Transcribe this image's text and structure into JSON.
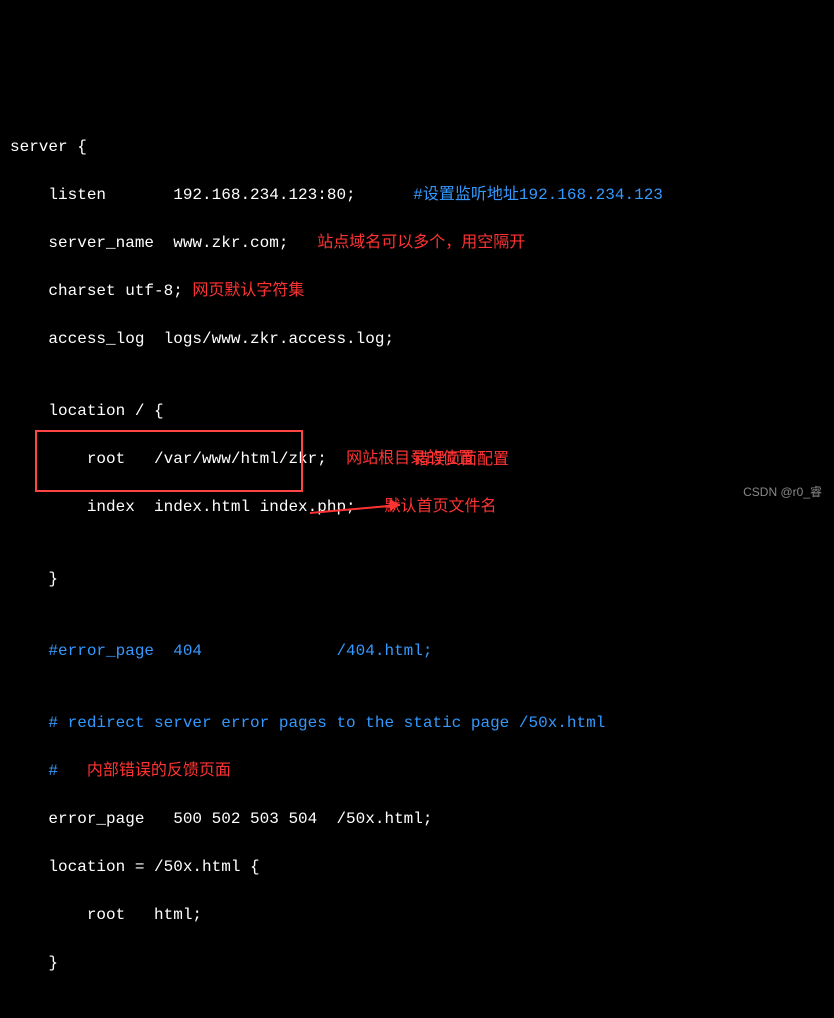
{
  "lines": {
    "l1": "server {",
    "l2a": "    listen       192.168.234.123:80;",
    "l2b": "      #设置监听地址192.168.234.123",
    "l3a": "    server_name  www.zkr.com;",
    "l3b": "   站点域名可以多个，用空隔开",
    "l4a": "    charset utf-8;",
    "l4b": " 网页默认字符集",
    "l5": "    access_log  logs/www.zkr.access.log;",
    "l6": "",
    "l7": "    location / {",
    "l8a": "        root   /var/www/html/zkr;",
    "l8b": "  网站根目录的位置",
    "l9a": "        index  index.html index.php;",
    "l9b": "   默认首页文件名",
    "l10": "",
    "l11": "    }",
    "l12": "",
    "l13": "    #error_page  404              /404.html;",
    "l14": "",
    "l15": "    # redirect server error pages to the static page /50x.html",
    "l16a": "    #",
    "l16b": "   内部错误的反馈页面",
    "l17": "    error_page   500 502 503 504  /50x.html;",
    "l18": "    location = /50x.html {",
    "l19": "        root   html;",
    "l20": "    }"
  },
  "labels": {
    "arrow": "错误页面配置"
  },
  "watermark": "CSDN @r0_睿"
}
